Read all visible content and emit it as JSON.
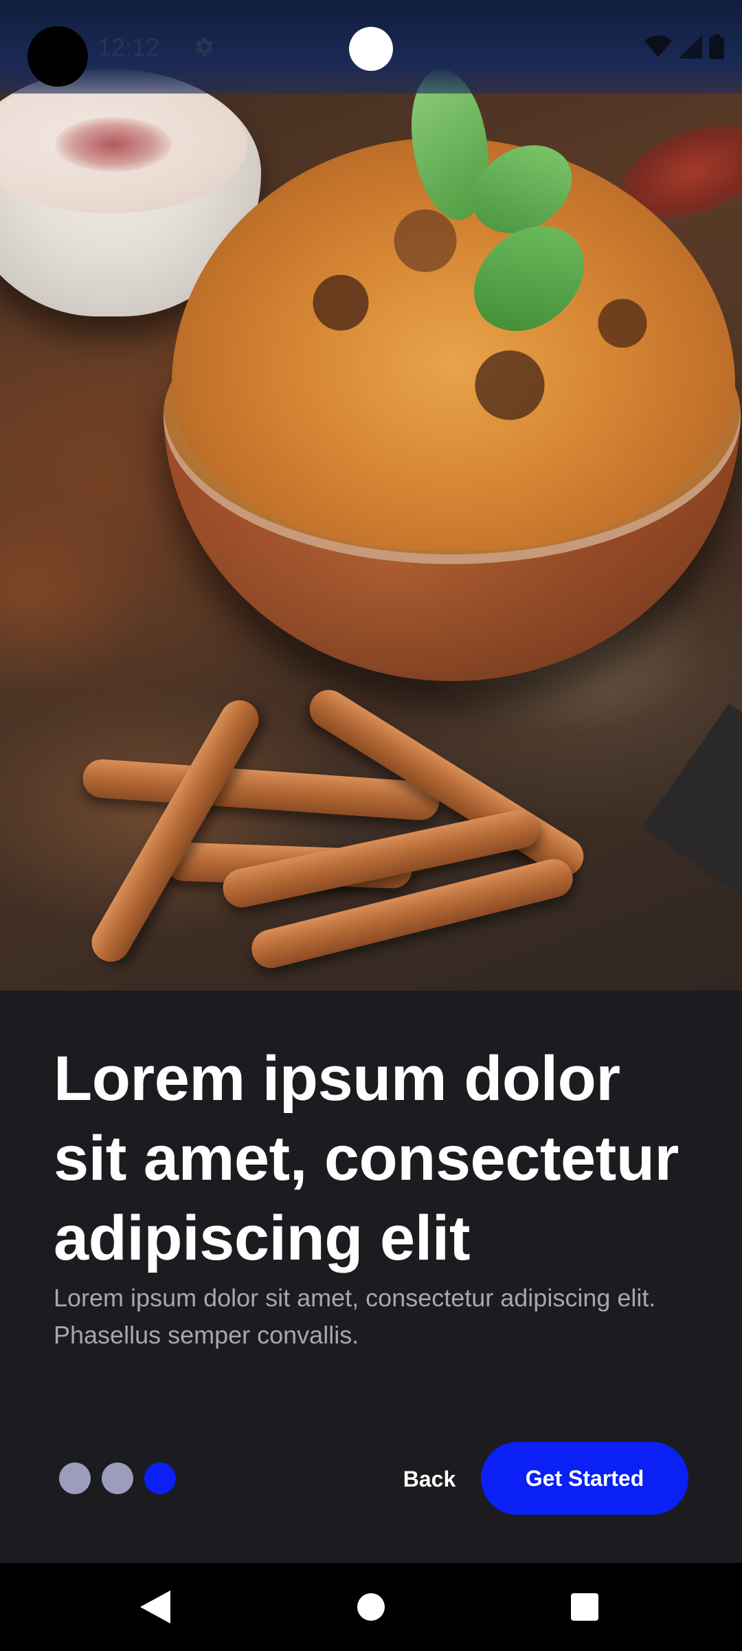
{
  "status_bar": {
    "time": "12:12",
    "icons": [
      "gear-icon",
      "wifi-icon",
      "cellular-signal-icon",
      "battery-icon"
    ]
  },
  "onboarding": {
    "headline": "Lorem ipsum dolor sit amet, consectetur adipiscing elit",
    "description": "Lorem ipsum dolor sit amet, consectetur adipiscing elit. Phasellus semper convallis.",
    "page_indicator": {
      "total": 3,
      "current": 3
    },
    "back_label": "Back",
    "primary_label": "Get Started"
  },
  "nav_bar": {
    "buttons": [
      "back-icon",
      "home-icon",
      "recents-icon"
    ]
  },
  "colors": {
    "background": "#1c1b20",
    "accent": "#0a20f5",
    "dot_inactive": "#9c9cbc",
    "text_primary": "#ffffff",
    "text_secondary": "#a8a6ae",
    "nav_bar": "#000000"
  }
}
